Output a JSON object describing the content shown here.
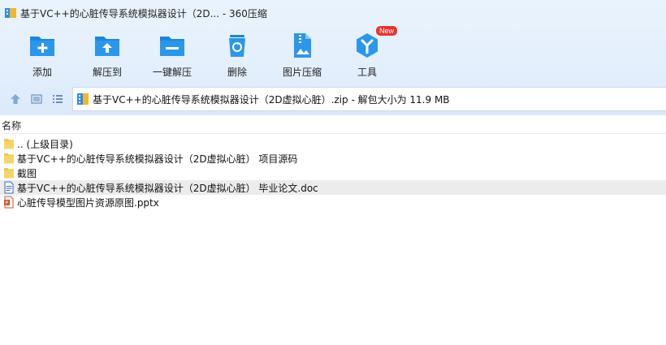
{
  "window": {
    "title": "基于VC++的心脏传导系统模拟器设计（2D... - 360压缩"
  },
  "toolbar": {
    "items": [
      {
        "label": "添加",
        "icon": "add-icon"
      },
      {
        "label": "解压到",
        "icon": "extract-to-icon"
      },
      {
        "label": "一键解压",
        "icon": "one-click-extract-icon"
      },
      {
        "label": "删除",
        "icon": "delete-icon"
      },
      {
        "label": "图片压缩",
        "icon": "image-compress-icon"
      },
      {
        "label": "工具",
        "icon": "tools-icon",
        "badge": "New"
      }
    ]
  },
  "address": {
    "text": "基于VC++的心脏传导系统模拟器设计（2D虚拟心脏）.zip - 解包大小为 11.9 MB"
  },
  "list": {
    "column_header": "名称",
    "items": [
      {
        "name": ".. (上级目录)",
        "type": "folder"
      },
      {
        "name": "基于VC++的心脏传导系统模拟器设计（2D虚拟心脏） 项目源码",
        "type": "folder"
      },
      {
        "name": "截图",
        "type": "folder"
      },
      {
        "name": "基于VC++的心脏传导系统模拟器设计（2D虚拟心脏） 毕业论文.doc",
        "type": "doc",
        "selected": true
      },
      {
        "name": "心脏传导模型图片资源原图.pptx",
        "type": "pptx"
      }
    ]
  },
  "colors": {
    "accent": "#2a8fe0",
    "toolbar_bg": "#e3effc",
    "badge": "#e8332f",
    "selected_row": "#ececec",
    "folder": "#f5c542"
  }
}
